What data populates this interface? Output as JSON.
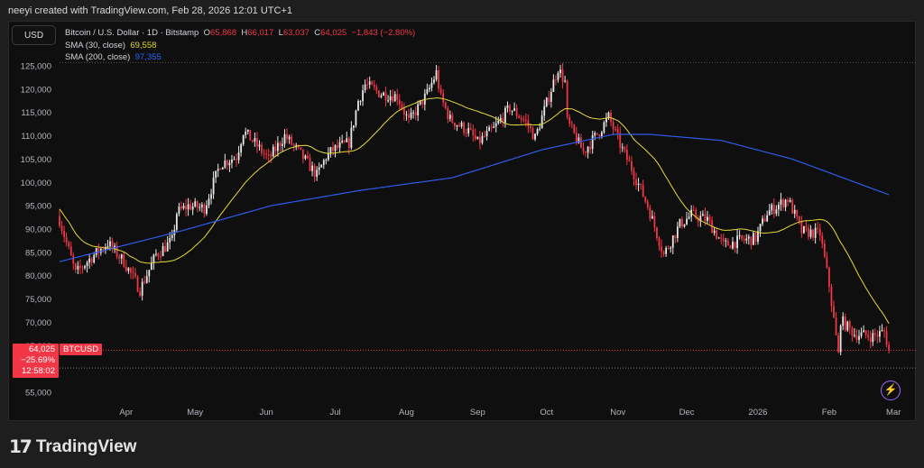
{
  "credit": "neeyi created with TradingView.com, Feb 28, 2026 12:01 UTC+1",
  "currency_button": "USD",
  "legend": {
    "symbol": "Bitcoin / U.S. Dollar · 1D · Bitstamp",
    "o_label": "O",
    "o": "65,868",
    "h_label": "H",
    "h": "66,017",
    "l_label": "L",
    "l": "63,037",
    "c_label": "C",
    "c": "64,025",
    "change": "−1,843 (−2.80%)",
    "sma30_label": "SMA (30, close)",
    "sma30": "69,558",
    "sma200_label": "SMA (200, close)",
    "sma200": "97,355"
  },
  "price_tag": {
    "price": "64,025",
    "change_pct": "−25.69%",
    "countdown": "12:58:02",
    "symbol": "BTCUSD"
  },
  "logo": "TradingView",
  "colors": {
    "up": "#e8e8e8",
    "down": "#f23645",
    "sma30": "#e6d93a",
    "sma200": "#2f5bea"
  },
  "chart_data": {
    "type": "candlestick",
    "title": "Bitcoin / U.S. Dollar · 1D · Bitstamp",
    "start_date": "2025-03-03",
    "end_date": "2026-02-27",
    "ylim": [
      53000,
      128000
    ],
    "y_ticks": [
      55000,
      60000,
      65000,
      70000,
      75000,
      80000,
      85000,
      90000,
      95000,
      100000,
      105000,
      110000,
      115000,
      120000,
      125000
    ],
    "y_tick_labels": [
      "55,000",
      "60,000",
      "65,000",
      "70,000",
      "75,000",
      "80,000",
      "85,000",
      "90,000",
      "95,000",
      "100,000",
      "105,000",
      "110,000",
      "115,000",
      "120,000",
      "125,000"
    ],
    "x_labels": [
      {
        "label": "Apr",
        "day": 29
      },
      {
        "label": "May",
        "day": 59
      },
      {
        "label": "Jun",
        "day": 90
      },
      {
        "label": "Jul",
        "day": 120
      },
      {
        "label": "Aug",
        "day": 151
      },
      {
        "label": "Sep",
        "day": 182
      },
      {
        "label": "Oct",
        "day": 212
      },
      {
        "label": "Nov",
        "day": 243
      },
      {
        "label": "Dec",
        "day": 273
      },
      {
        "label": "2026",
        "day": 304
      },
      {
        "label": "Feb",
        "day": 335
      },
      {
        "label": "Mar",
        "day": 363
      }
    ],
    "close_anchors": [
      [
        0,
        92000
      ],
      [
        7,
        80500
      ],
      [
        14,
        84000
      ],
      [
        21,
        87000
      ],
      [
        28,
        83000
      ],
      [
        35,
        77000
      ],
      [
        42,
        84500
      ],
      [
        49,
        87500
      ],
      [
        51,
        93500
      ],
      [
        56,
        95000
      ],
      [
        63,
        94500
      ],
      [
        70,
        104000
      ],
      [
        77,
        105500
      ],
      [
        80,
        111000
      ],
      [
        84,
        109000
      ],
      [
        91,
        105000
      ],
      [
        98,
        110000
      ],
      [
        105,
        106000
      ],
      [
        112,
        101500
      ],
      [
        116,
        105500
      ],
      [
        119,
        107000
      ],
      [
        126,
        108500
      ],
      [
        130,
        117500
      ],
      [
        133,
        121000
      ],
      [
        140,
        119000
      ],
      [
        147,
        118500
      ],
      [
        152,
        113000
      ],
      [
        160,
        119000
      ],
      [
        164,
        123500
      ],
      [
        166,
        118000
      ],
      [
        170,
        113500
      ],
      [
        178,
        111000
      ],
      [
        182,
        108500
      ],
      [
        189,
        111500
      ],
      [
        196,
        116000
      ],
      [
        203,
        113000
      ],
      [
        207,
        109500
      ],
      [
        212,
        117000
      ],
      [
        217,
        124500
      ],
      [
        220,
        121500
      ],
      [
        221,
        113000
      ],
      [
        228,
        106500
      ],
      [
        235,
        111000
      ],
      [
        239,
        114000
      ],
      [
        245,
        107000
      ],
      [
        249,
        103000
      ],
      [
        256,
        95000
      ],
      [
        263,
        84500
      ],
      [
        270,
        91000
      ],
      [
        275,
        93000
      ],
      [
        282,
        92000
      ],
      [
        289,
        86500
      ],
      [
        296,
        87500
      ],
      [
        303,
        88000
      ],
      [
        308,
        93500
      ],
      [
        317,
        96500
      ],
      [
        323,
        89500
      ],
      [
        331,
        89000
      ],
      [
        335,
        78000
      ],
      [
        339,
        63000
      ],
      [
        340,
        70500
      ],
      [
        346,
        67500
      ],
      [
        354,
        67000
      ],
      [
        359,
        68000
      ],
      [
        361,
        64025
      ]
    ],
    "sma200_anchors": [
      [
        0,
        83000
      ],
      [
        53,
        89600
      ],
      [
        92,
        95000
      ],
      [
        131,
        98300
      ],
      [
        171,
        101000
      ],
      [
        210,
        107000
      ],
      [
        241,
        110300
      ],
      [
        257,
        110300
      ],
      [
        288,
        109000
      ],
      [
        319,
        105000
      ],
      [
        361,
        97355
      ]
    ],
    "last_price": 64025,
    "timer_line": 60200
  }
}
